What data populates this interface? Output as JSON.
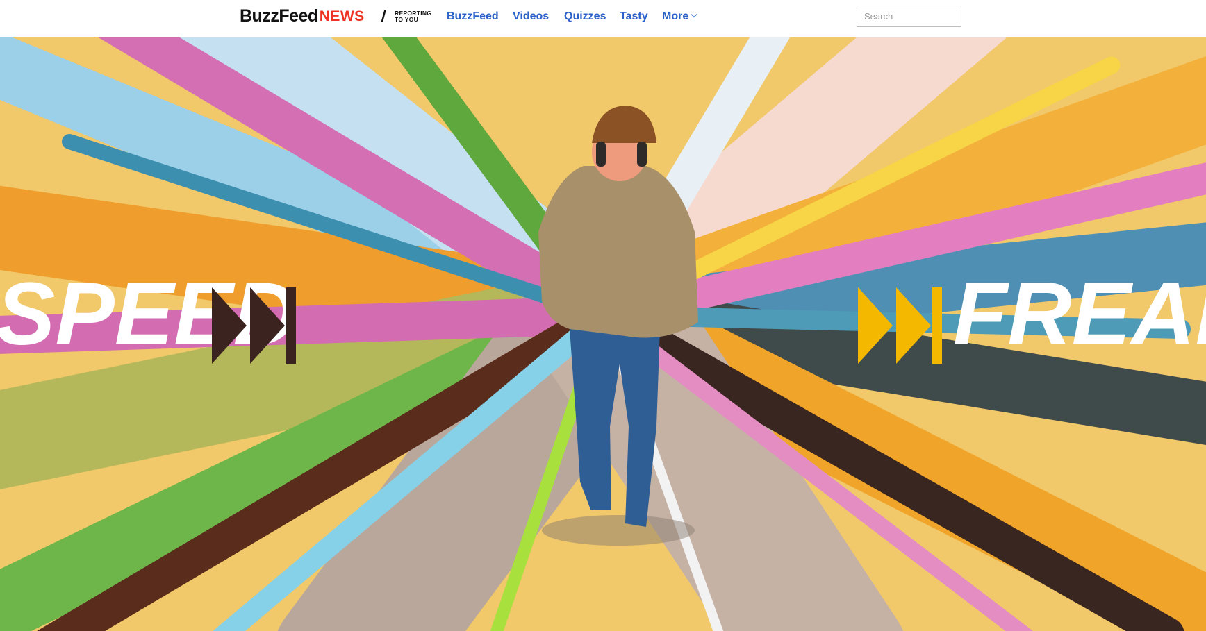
{
  "header": {
    "logo": {
      "brand": "BuzzFeed",
      "section": "NEWS",
      "tagline_line1": "REPORTING",
      "tagline_line2": "TO YOU"
    },
    "nav": [
      {
        "label": "BuzzFeed"
      },
      {
        "label": "Videos"
      },
      {
        "label": "Quizzes"
      },
      {
        "label": "Tasty"
      },
      {
        "label": "More"
      }
    ],
    "search": {
      "placeholder": "Search",
      "value": ""
    }
  },
  "hero": {
    "word_left": "SPEED",
    "word_right": "FREAKS",
    "colors": {
      "left_arrows": "#3b2420",
      "right_arrows": "#f5b800",
      "text": "#ffffff"
    }
  }
}
